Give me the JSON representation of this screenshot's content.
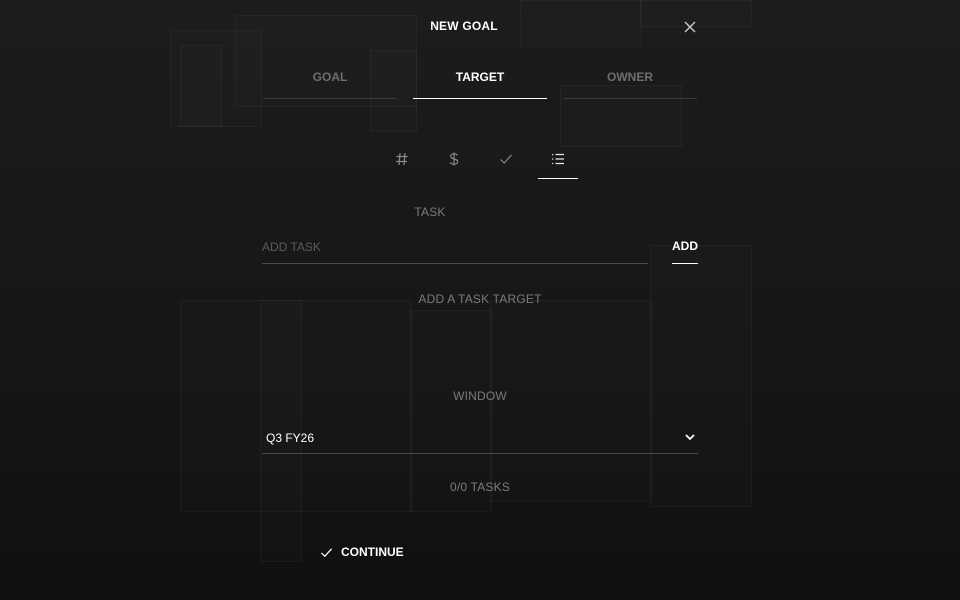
{
  "modal": {
    "title": "NEW GOAL",
    "close_icon": "close-icon"
  },
  "tabs": [
    {
      "label": "GOAL",
      "active": false
    },
    {
      "label": "TARGET",
      "active": true
    },
    {
      "label": "OWNER",
      "active": false
    }
  ],
  "target_types": [
    {
      "icon": "hash-icon",
      "active": false
    },
    {
      "icon": "dollar-icon",
      "active": false
    },
    {
      "icon": "check-icon",
      "active": false
    },
    {
      "icon": "list-icon",
      "active": true
    }
  ],
  "task": {
    "label": "TASK",
    "placeholder": "ADD TASK",
    "value": "",
    "add_label": "ADD",
    "hint": "ADD A TASK TARGET"
  },
  "window": {
    "label": "WINDOW",
    "selected": "Q3 FY26",
    "chevron_icon": "chevron-down-icon"
  },
  "count": "0/0 TASKS",
  "continue_label": "CONTINUE",
  "colors": {
    "background": "#121212",
    "text": "#ffffff",
    "muted": "#7b7b7b",
    "divider": "#4a4a4a"
  }
}
